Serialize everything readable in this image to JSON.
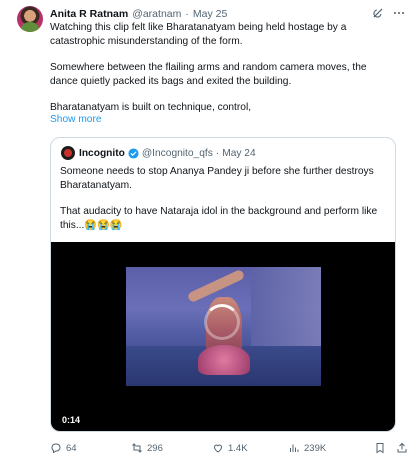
{
  "tweet": {
    "author_name": "Anita R Ratnam",
    "handle": "@aratnam",
    "separator": "·",
    "date": "May 25",
    "paragraphs": [
      "Watching this clip felt like Bharatanatyam being held hostage by a catastrophic misunderstanding of the form.",
      "Somewhere between the flailing arms and random camera moves, the dance quietly packed its bags and exited the building.",
      "Bharatanatyam is built on technique, control,"
    ],
    "show_more": "Show more"
  },
  "quote": {
    "author_name": "Incognito",
    "handle": "@Incognito_qfs",
    "separator": "·",
    "date": "May 24",
    "paragraphs": [
      "Someone needs to stop Ananya Pandey ji before she further destroys Bharatanatyam.",
      "That audacity to have Nataraja idol in the background and perform like this...😭😭😭"
    ],
    "video_timestamp": "0:14"
  },
  "actions": {
    "replies": "64",
    "retweets": "296",
    "likes": "1.4K",
    "views": "239K"
  },
  "icons": [
    "grok-icon",
    "more-icon",
    "verified-icon",
    "reply-icon",
    "retweet-icon",
    "like-icon",
    "views-icon",
    "bookmark-icon",
    "share-icon"
  ],
  "colors": {
    "accent": "#1d9bf0",
    "text": "#0f1419",
    "secondary": "#536471",
    "border": "#cfd9de"
  }
}
